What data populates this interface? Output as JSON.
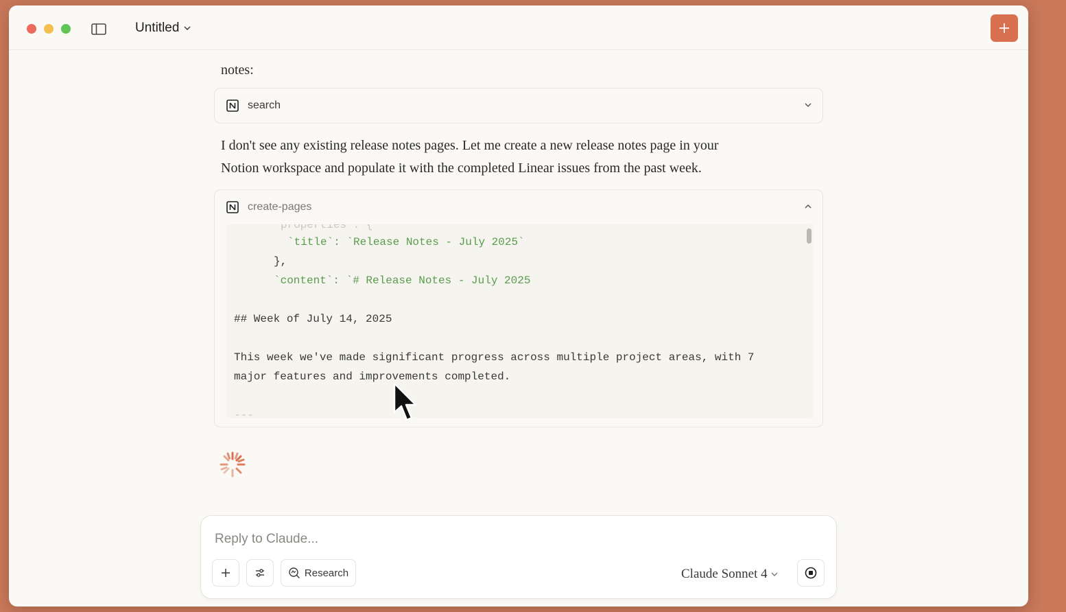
{
  "window": {
    "title": "Untitled"
  },
  "messages": {
    "prose_top": "notes:",
    "prose_middle_line1": "I don't see any existing release notes pages. Let me create a new release notes page in your",
    "prose_middle_line2": "Notion workspace and populate it with the completed Linear issues from the past week."
  },
  "tools": [
    {
      "name": "search",
      "state": "collapsed"
    },
    {
      "name": "create-pages",
      "state": "expanded"
    }
  ],
  "code": {
    "line_properties": "properties : {",
    "line_title": "`title`: `Release Notes - July 2025`",
    "line_close": "},",
    "line_content": "`content`: `# Release Notes - July 2025",
    "line_heading": "## Week of July 14, 2025",
    "line_body1": "This week we've made significant progress across multiple project areas, with 7",
    "line_body2": "major features and improvements completed.",
    "line_rule": "---"
  },
  "composer": {
    "placeholder": "Reply to Claude...",
    "research_label": "Research",
    "model": "Claude Sonnet 4"
  },
  "colors": {
    "accent": "#d9704f",
    "background": "#faf9f5",
    "code_green": "#5a9b4d"
  }
}
